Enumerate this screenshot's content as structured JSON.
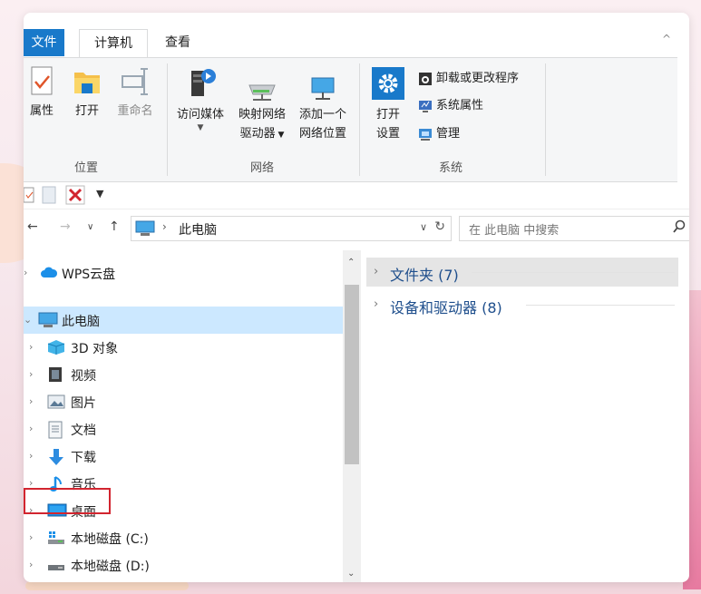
{
  "tabs": {
    "file": "文件",
    "computer": "计算机",
    "view": "查看"
  },
  "ribbon": {
    "location": {
      "group_label": "位置",
      "properties": "属性",
      "open": "打开",
      "rename": "重命名"
    },
    "network": {
      "group_label": "网络",
      "access_media": "访问媒体",
      "map_drive_line1": "映射网络",
      "map_drive_line2": "驱动器",
      "add_location_line1": "添加一个",
      "add_location_line2": "网络位置"
    },
    "system": {
      "group_label": "系统",
      "open_settings_line1": "打开",
      "open_settings_line2": "设置",
      "uninstall": "卸载或更改程序",
      "system_properties": "系统属性",
      "manage": "管理"
    }
  },
  "address": {
    "path": "此电脑",
    "search_placeholder": "在 此电脑 中搜索"
  },
  "tree": [
    {
      "label": "WPS云盘",
      "icon": "cloud-icon"
    },
    {
      "label": "此电脑",
      "icon": "computer-icon",
      "selected": true
    },
    {
      "label": "3D 对象",
      "icon": "cube-3d-icon"
    },
    {
      "label": "视频",
      "icon": "video-icon"
    },
    {
      "label": "图片",
      "icon": "picture-icon"
    },
    {
      "label": "文档",
      "icon": "document-icon"
    },
    {
      "label": "下载",
      "icon": "download-arrow-icon"
    },
    {
      "label": "音乐",
      "icon": "music-note-icon"
    },
    {
      "label": "桌面",
      "icon": "desktop-icon",
      "highlighted": true
    },
    {
      "label": "本地磁盘 (C:)",
      "icon": "system-drive-icon"
    },
    {
      "label": "本地磁盘 (D:)",
      "icon": "drive-icon"
    }
  ],
  "content": {
    "folders_header": "文件夹 (7)",
    "devices_header": "设备和驱动器 (8)"
  },
  "colors": {
    "accent": "#1979ca",
    "selection": "#cce8ff",
    "highlight_box": "#d2252f",
    "header_text": "#1e4e8c"
  }
}
